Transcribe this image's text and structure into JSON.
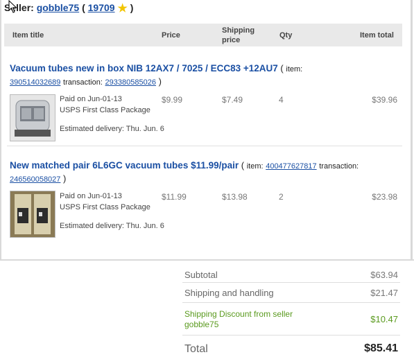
{
  "seller": {
    "label": "Seller:",
    "username": "gobble75",
    "open_paren": "(",
    "feedback_score": "19709",
    "close_paren": ")"
  },
  "table_header": {
    "item_title": "Item title",
    "price": "Price",
    "shipping_price_line1": "Shipping",
    "shipping_price_line2": "price",
    "qty": "Qty",
    "item_total": "Item total"
  },
  "items": [
    {
      "title": "Vacuum tubes new in box NIB 12AX7 / 7025 / ECC83 +12AU7",
      "open_paren": "(",
      "item_label": "item:",
      "item_number": "390514032689",
      "transaction_label": "transaction:",
      "transaction_number": "293380585026",
      "close_paren": ")",
      "paid_on": "Paid on Jun-01-13",
      "shipping_service": "USPS First Class Package",
      "estimated_delivery": "Estimated delivery: Thu. Jun. 6",
      "price": "$9.99",
      "shipping_price": "$7.49",
      "qty": "4",
      "item_total": "$39.96"
    },
    {
      "title": "New matched pair 6L6GC vacuum tubes $11.99/pair",
      "open_paren": "(",
      "item_label": "item:",
      "item_number": "400477627817",
      "transaction_label": "transaction:",
      "transaction_number": "246560058027",
      "close_paren": ")",
      "paid_on": "Paid on Jun-01-13",
      "shipping_service": "USPS First Class Package",
      "estimated_delivery": "Estimated delivery: Thu. Jun. 6",
      "price": "$11.99",
      "shipping_price": "$13.98",
      "qty": "2",
      "item_total": "$23.98"
    }
  ],
  "summary": {
    "subtotal_label": "Subtotal",
    "subtotal_value": "$63.94",
    "shipping_label": "Shipping and handling",
    "shipping_value": "$21.47",
    "discount_label_line1": "Shipping Discount from seller",
    "discount_label_line2": "gobble75",
    "discount_value": "$10.47",
    "total_label": "Total",
    "total_value": "$85.41"
  },
  "colors": {
    "link": "#1a4fa3",
    "discount_green": "#5a9a1e",
    "header_bg": "#e9e9e9",
    "star": "#f2c500"
  },
  "icons": {
    "seller_star": "yellow-star-icon",
    "cursor": "mouse-cursor-icon"
  }
}
